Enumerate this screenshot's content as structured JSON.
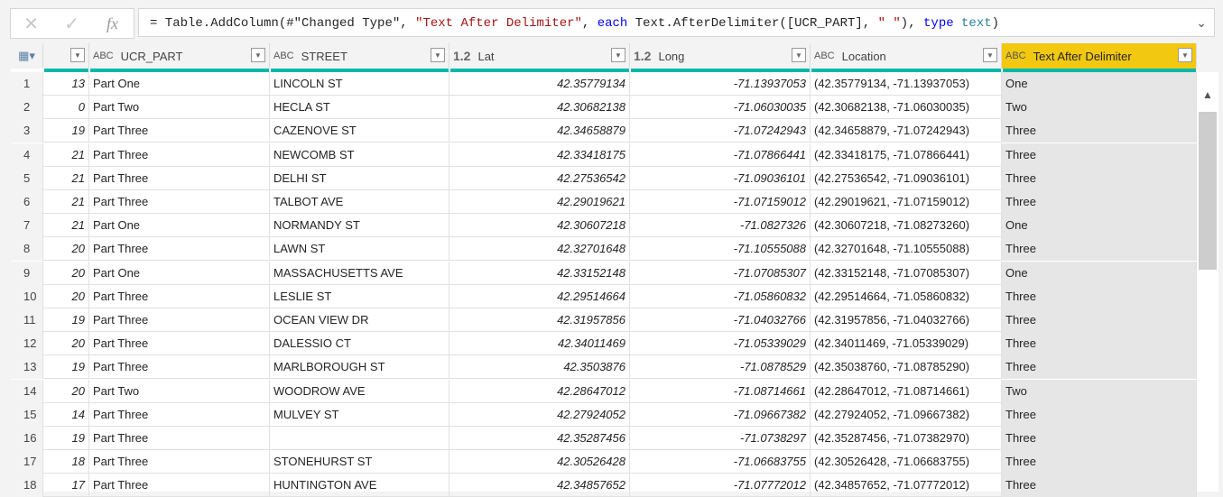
{
  "formula_bar": {
    "cancel_icon": "✕",
    "commit_icon": "✓",
    "fx_label": "fx",
    "parts": [
      {
        "t": "= Table.AddColumn(#\"Changed Type\", ",
        "c": ""
      },
      {
        "t": "\"Text After Delimiter\"",
        "c": "str"
      },
      {
        "t": ", ",
        "c": ""
      },
      {
        "t": "each",
        "c": "kw"
      },
      {
        "t": " Text.AfterDelimiter([UCR_PART], ",
        "c": ""
      },
      {
        "t": "\" \"",
        "c": "str"
      },
      {
        "t": "), ",
        "c": ""
      },
      {
        "t": "type",
        "c": "kw"
      },
      {
        "t": " ",
        "c": ""
      },
      {
        "t": "text",
        "c": "ty"
      },
      {
        "t": ")",
        "c": ""
      }
    ]
  },
  "columns": [
    {
      "type": "",
      "name": ""
    },
    {
      "type": "ABC",
      "name": "UCR_PART"
    },
    {
      "type": "ABC",
      "name": "STREET"
    },
    {
      "type": "1.2",
      "name": "Lat"
    },
    {
      "type": "1.2",
      "name": "Long"
    },
    {
      "type": "ABC",
      "name": "Location"
    },
    {
      "type": "ABC",
      "name": "Text After Delimiter"
    }
  ],
  "rows": [
    [
      "1",
      "13",
      "Part One",
      "LINCOLN ST",
      "42.35779134",
      "-71.13937053",
      "(42.35779134, -71.13937053)",
      "One"
    ],
    [
      "2",
      "0",
      "Part Two",
      "HECLA ST",
      "42.30682138",
      "-71.06030035",
      "(42.30682138, -71.06030035)",
      "Two"
    ],
    [
      "3",
      "19",
      "Part Three",
      "CAZENOVE ST",
      "42.34658879",
      "-71.07242943",
      "(42.34658879, -71.07242943)",
      "Three"
    ],
    [
      "4",
      "21",
      "Part Three",
      "NEWCOMB ST",
      "42.33418175",
      "-71.07866441",
      "(42.33418175, -71.07866441)",
      "Three"
    ],
    [
      "5",
      "21",
      "Part Three",
      "DELHI ST",
      "42.27536542",
      "-71.09036101",
      "(42.27536542, -71.09036101)",
      "Three"
    ],
    [
      "6",
      "21",
      "Part Three",
      "TALBOT AVE",
      "42.29019621",
      "-71.07159012",
      "(42.29019621, -71.07159012)",
      "Three"
    ],
    [
      "7",
      "21",
      "Part One",
      "NORMANDY ST",
      "42.30607218",
      "-71.0827326",
      "(42.30607218, -71.08273260)",
      "One"
    ],
    [
      "8",
      "20",
      "Part Three",
      "LAWN ST",
      "42.32701648",
      "-71.10555088",
      "(42.32701648, -71.10555088)",
      "Three"
    ],
    [
      "9",
      "20",
      "Part One",
      "MASSACHUSETTS AVE",
      "42.33152148",
      "-71.07085307",
      "(42.33152148, -71.07085307)",
      "One"
    ],
    [
      "10",
      "20",
      "Part Three",
      "LESLIE ST",
      "42.29514664",
      "-71.05860832",
      "(42.29514664, -71.05860832)",
      "Three"
    ],
    [
      "11",
      "19",
      "Part Three",
      "OCEAN VIEW DR",
      "42.31957856",
      "-71.04032766",
      "(42.31957856, -71.04032766)",
      "Three"
    ],
    [
      "12",
      "20",
      "Part Three",
      "DALESSIO CT",
      "42.34011469",
      "-71.05339029",
      "(42.34011469, -71.05339029)",
      "Three"
    ],
    [
      "13",
      "19",
      "Part Three",
      "MARLBOROUGH ST",
      "42.3503876",
      "-71.0878529",
      "(42.35038760, -71.08785290)",
      "Three"
    ],
    [
      "14",
      "20",
      "Part Two",
      "WOODROW AVE",
      "42.28647012",
      "-71.08714661",
      "(42.28647012, -71.08714661)",
      "Two"
    ],
    [
      "15",
      "14",
      "Part Three",
      "MULVEY ST",
      "42.27924052",
      "-71.09667382",
      "(42.27924052, -71.09667382)",
      "Three"
    ],
    [
      "16",
      "19",
      "Part Three",
      "",
      "42.35287456",
      "-71.0738297",
      "(42.35287456, -71.07382970)",
      "Three"
    ],
    [
      "17",
      "18",
      "Part Three",
      "STONEHURST ST",
      "42.30526428",
      "-71.06683755",
      "(42.30526428, -71.06683755)",
      "Three"
    ],
    [
      "18",
      "17",
      "Part Three",
      "HUNTINGTON AVE",
      "42.34857652",
      "-71.07772012",
      "(42.34857652, -71.07772012)",
      "Three"
    ]
  ]
}
